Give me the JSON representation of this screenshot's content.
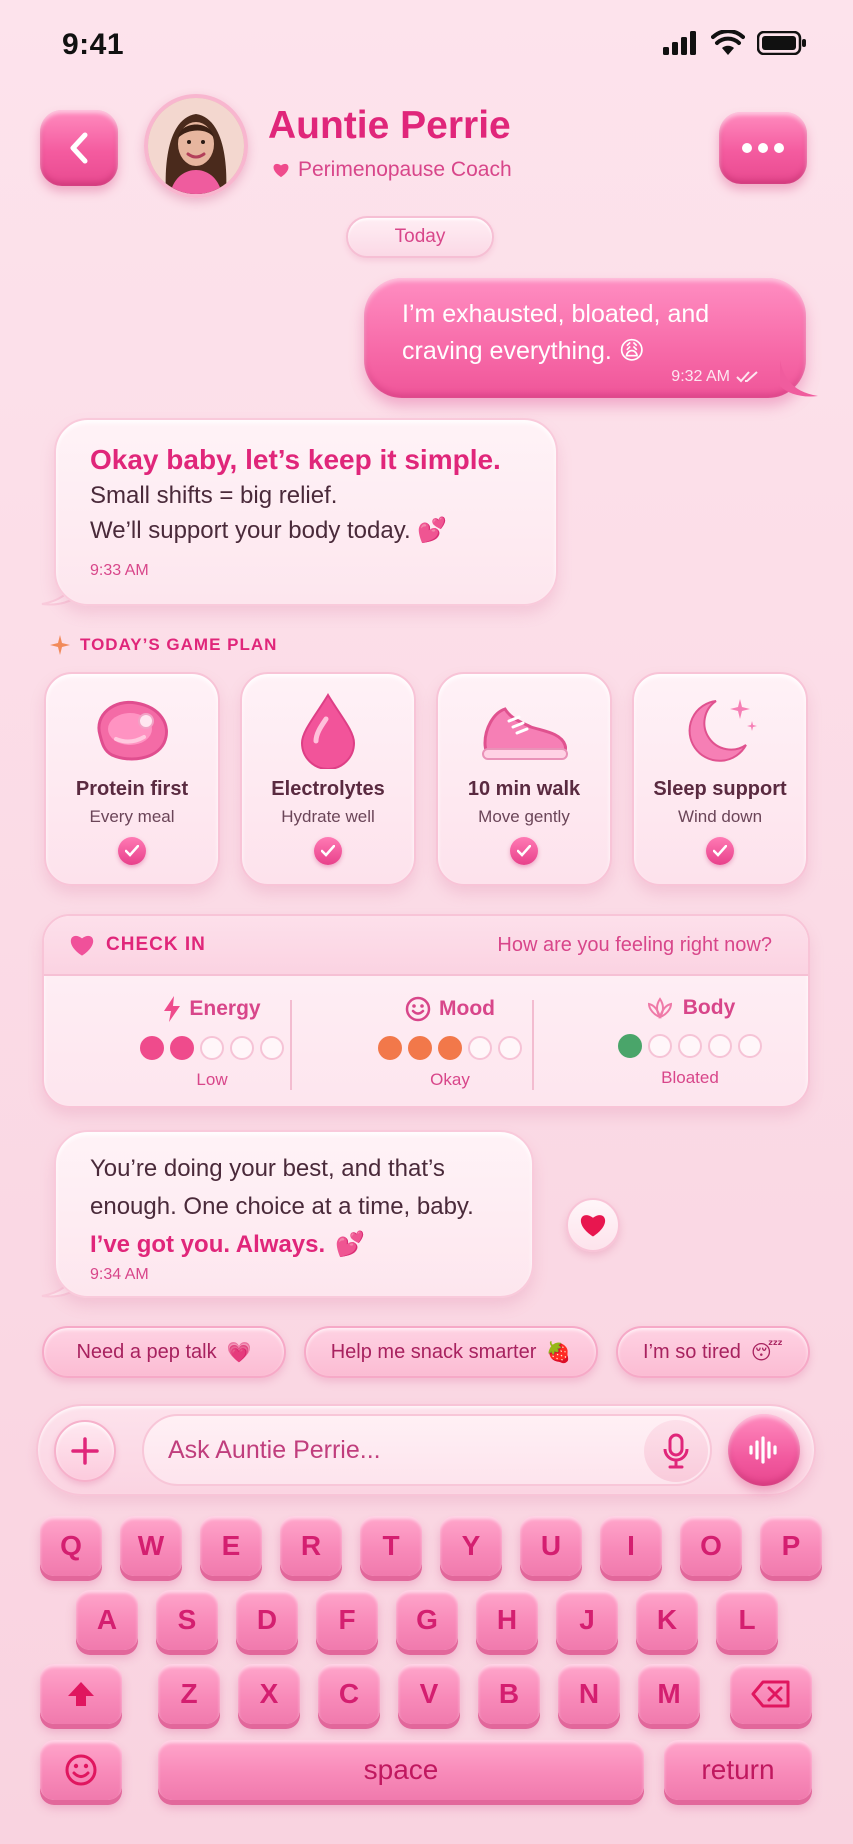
{
  "status_bar": {
    "time": "9:41"
  },
  "header": {
    "name": "Auntie Perrie",
    "subtitle": "Perimenopause Coach"
  },
  "date_divider": "Today",
  "messages": {
    "user": {
      "line1": "I’m exhausted, bloated, and",
      "line2": "craving everything. 😩",
      "time": "9:32 AM"
    },
    "bot1": {
      "title": "Okay baby, let’s keep it simple.",
      "line1": "Small shifts = big relief.",
      "line2": "We’ll support your body today. 💕",
      "time": "9:33 AM"
    },
    "bot2": {
      "line1": "You’re doing your best, and that’s",
      "line2": "enough. One choice at a time, baby.",
      "bold": "I’ve got you. Always.",
      "bold_emoji": "💕",
      "time": "9:34 AM"
    }
  },
  "game_plan": {
    "label": "TODAY’S GAME PLAN",
    "items": [
      {
        "title": "Protein first",
        "sub": "Every meal",
        "icon": "steak-icon",
        "done": true
      },
      {
        "title": "Electrolytes",
        "sub": "Hydrate well",
        "icon": "water-drop-icon",
        "done": true
      },
      {
        "title": "10 min walk",
        "sub": "Move gently",
        "icon": "sneaker-icon",
        "done": true
      },
      {
        "title": "Sleep support",
        "sub": "Wind down",
        "icon": "moon-icon",
        "done": true
      }
    ]
  },
  "check_in": {
    "title": "CHECK IN",
    "question": "How are you feeling right now?",
    "metrics": [
      {
        "name": "Energy",
        "value": 2,
        "max": 5,
        "label": "Low",
        "color": "#ef4b8c"
      },
      {
        "name": "Mood",
        "value": 3,
        "max": 5,
        "label": "Okay",
        "color": "#f2784a"
      },
      {
        "name": "Body",
        "value": 1,
        "max": 5,
        "label": "Bloated",
        "color": "#4aa56a"
      }
    ]
  },
  "quick_replies": [
    {
      "label": "Need a pep talk",
      "emoji": "💗"
    },
    {
      "label": "Help me snack smarter",
      "emoji": "🍓"
    },
    {
      "label": "I’m so tired",
      "emoji": "😴"
    }
  ],
  "composer": {
    "placeholder": "Ask Auntie Perrie..."
  },
  "keyboard": {
    "row1": [
      "Q",
      "W",
      "E",
      "R",
      "T",
      "Y",
      "U",
      "I",
      "O",
      "P"
    ],
    "row2": [
      "A",
      "S",
      "D",
      "F",
      "G",
      "H",
      "J",
      "K",
      "L"
    ],
    "row3": [
      "Z",
      "X",
      "C",
      "V",
      "B",
      "N",
      "M"
    ],
    "space": "space",
    "return": "return"
  },
  "colors": {
    "accent": "#e0267a",
    "bubble_user": "#f76aa8",
    "background": "#fbdbe6"
  }
}
